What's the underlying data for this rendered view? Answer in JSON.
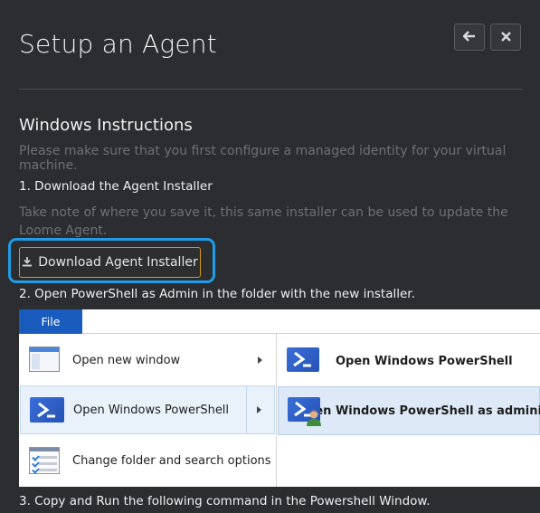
{
  "header": {
    "title": "Setup an Agent",
    "back_icon": "arrow-left-icon",
    "close_icon": "close-icon"
  },
  "windows": {
    "section_title": "Windows Instructions",
    "intro": "Please make sure that you first configure a managed identity for your virtual machine.",
    "step1": {
      "label": "1. Download the Agent Installer",
      "note": "Take note of where you save it, this same installer can be used to update the Loome Agent.",
      "button_label": "Download Agent Installer",
      "button_icon": "download-icon"
    },
    "step2": {
      "label": "2. Open PowerShell as Admin in the folder with the new installer."
    },
    "explorer": {
      "file_tab": "File",
      "left_items": [
        {
          "label": "Open new window",
          "icon": "new-window-icon"
        },
        {
          "label": "Open Windows PowerShell",
          "icon": "powershell-icon"
        },
        {
          "label": "Change folder and search options",
          "icon": "folder-options-icon"
        }
      ],
      "right_items": [
        {
          "label": "Open Windows PowerShell",
          "icon": "powershell-icon"
        },
        {
          "label": "Open Windows PowerShell as admini",
          "icon": "powershell-admin-icon"
        }
      ]
    },
    "step3": {
      "label": "3. Copy and Run the following command in the Powershell Window."
    }
  },
  "colors": {
    "background": "#2b2d30",
    "accent_border": "#d59a1d",
    "focus_ring": "#1e9ee8",
    "file_tab": "#1a5cbd"
  }
}
